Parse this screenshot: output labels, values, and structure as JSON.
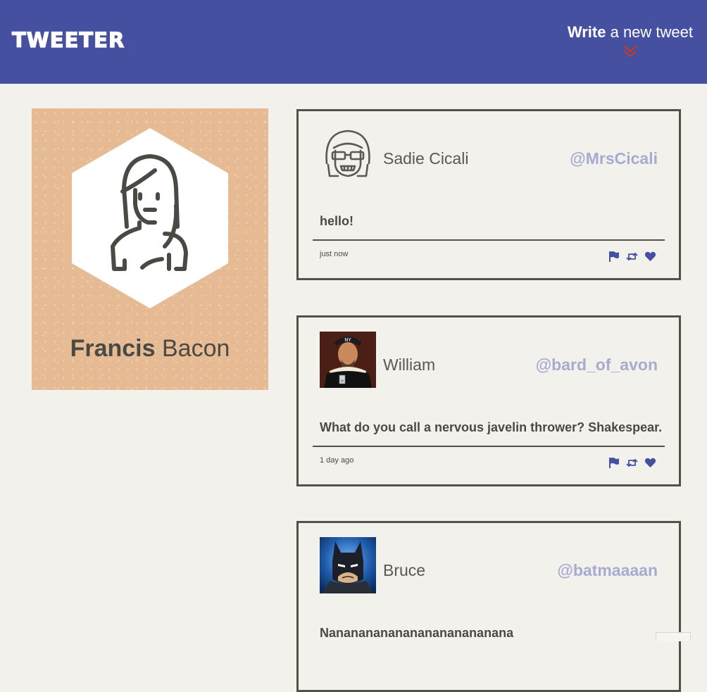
{
  "nav": {
    "logo": "TWEETER",
    "compose_strong": "Write",
    "compose_rest": " a new tweet",
    "compose_arrow_icon": "double-chevron-down-icon",
    "accent": "#4551a0",
    "arrow_color": "#c0392b"
  },
  "profile": {
    "first_name": "Francis",
    "last_name": " Bacon",
    "avatar_icon": "woman-avatar-icon",
    "background": "#e6bb94"
  },
  "tweets": [
    {
      "name": "Sadie Cicali",
      "handle": "@MrsCicali",
      "avatar_icon": "sunglasses-woman-avatar-icon",
      "content": "hello!",
      "time": "just now"
    },
    {
      "name": "William",
      "handle": "@bard_of_avon",
      "avatar_icon": "shakespeare-portrait",
      "content": "What do you call a nervous javelin thrower? Shakespear.",
      "time": "1 day ago"
    },
    {
      "name": "Bruce",
      "handle": "@batmaaaan",
      "avatar_icon": "batman-portrait",
      "content": "Nanananananananananananana",
      "time": ""
    }
  ],
  "actions": [
    "flag-icon",
    "retweet-icon",
    "heart-icon"
  ]
}
